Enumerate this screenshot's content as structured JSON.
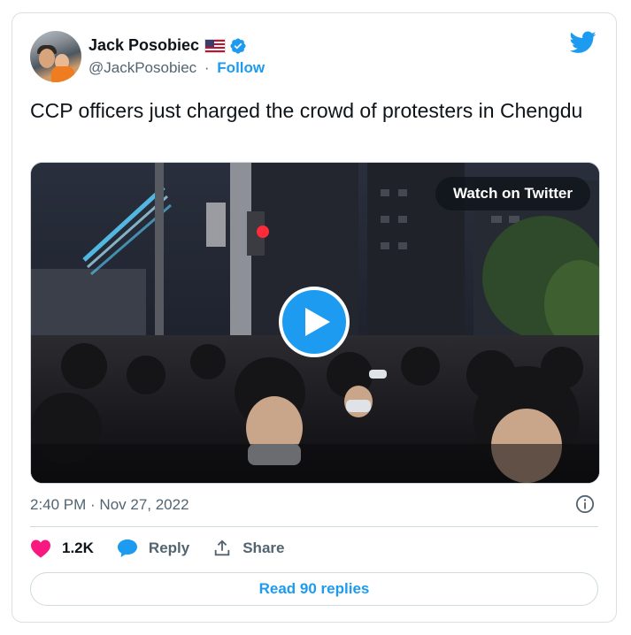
{
  "author": {
    "name": "Jack Posobiec",
    "handle": "@JackPosobiec",
    "separator": "·",
    "follow_label": "Follow"
  },
  "tweet": {
    "text": "CCP officers just charged the crowd of protesters in Chengdu",
    "timestamp": "2:40 PM · Nov 27, 2022"
  },
  "media": {
    "watch_label": "Watch on Twitter"
  },
  "actions": {
    "likes": "1.2K",
    "reply_label": "Reply",
    "share_label": "Share"
  },
  "read_replies_label": "Read 90 replies",
  "icons": {
    "brand": "twitter-bird-icon",
    "verified": "verified-badge-icon",
    "flag": "us-flag-icon",
    "like": "heart-icon",
    "reply": "comment-bubble-icon",
    "share": "share-upload-icon",
    "info": "info-icon",
    "play": "play-icon"
  },
  "colors": {
    "accent": "#1d9bf0",
    "like": "#f91880",
    "text": "#0f1419",
    "muted": "#536471",
    "border": "#cfd9de"
  }
}
